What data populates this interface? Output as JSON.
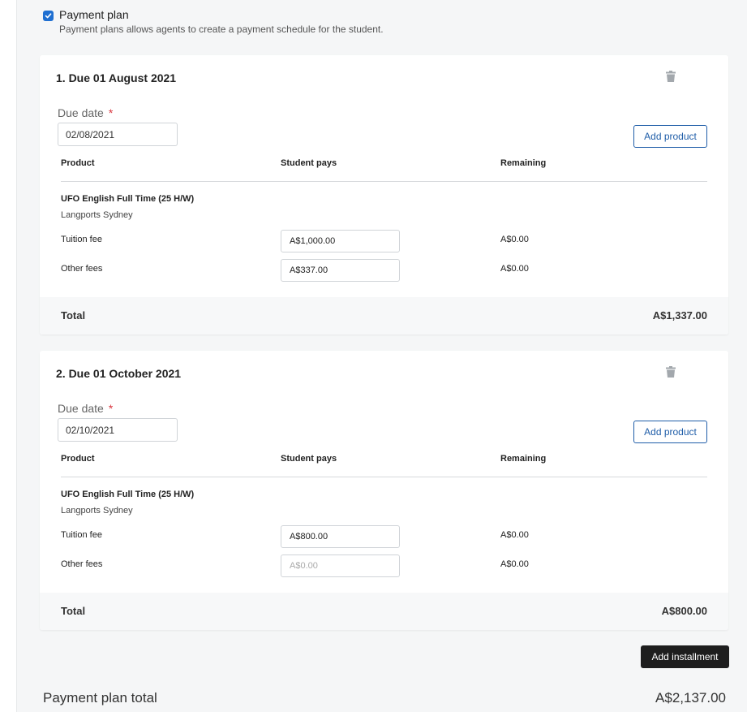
{
  "plan": {
    "checkbox_checked": true,
    "title": "Payment plan",
    "description": "Payment plans allows agents to create a payment schedule for the student."
  },
  "columns": {
    "product": "Product",
    "student_pays": "Student pays",
    "remaining": "Remaining"
  },
  "installments": [
    {
      "title": "1. Due 01 August 2021",
      "due_label": "Due date",
      "required_mark": "*",
      "due_value": "02/08/2021",
      "add_product_label": "Add product",
      "product_name": "UFO English Full Time (25 H/W)",
      "school": "Langports Sydney",
      "fees": [
        {
          "label": "Tuition fee",
          "value": "A$1,000.00",
          "placeholder": "",
          "remaining": "A$0.00"
        },
        {
          "label": "Other fees",
          "value": "A$337.00",
          "placeholder": "",
          "remaining": "A$0.00"
        }
      ],
      "total_label": "Total",
      "total": "A$1,337.00"
    },
    {
      "title": "2. Due 01 October 2021",
      "due_label": "Due date",
      "required_mark": "*",
      "due_value": "02/10/2021",
      "add_product_label": "Add product",
      "product_name": "UFO English Full Time (25 H/W)",
      "school": "Langports Sydney",
      "fees": [
        {
          "label": "Tuition fee",
          "value": "A$800.00",
          "placeholder": "",
          "remaining": "A$0.00"
        },
        {
          "label": "Other fees",
          "value": "",
          "placeholder": "A$0.00",
          "remaining": "A$0.00"
        }
      ],
      "total_label": "Total",
      "total": "A$800.00"
    }
  ],
  "add_installment_label": "Add installment",
  "grand_total": {
    "label": "Payment plan total",
    "value": "A$2,137.00"
  },
  "colors": {
    "accent": "#1f5da8",
    "checkbox": "#1f6fd1",
    "required": "#d9363e",
    "dark_button": "#1e1e1e"
  },
  "icons": {
    "delete": "trash-icon",
    "checkbox": "check-icon"
  }
}
